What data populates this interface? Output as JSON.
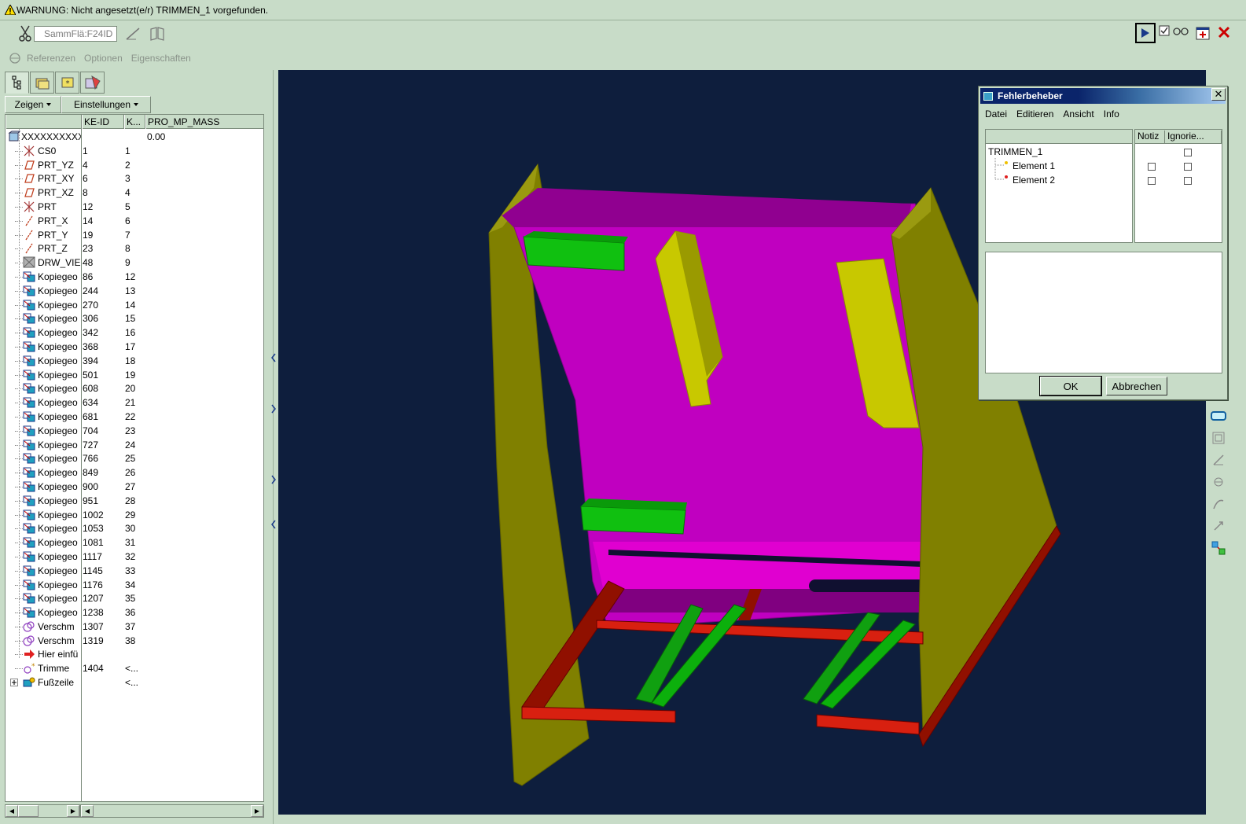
{
  "warning": {
    "text": "WARNUNG: Nicht angesetzt(e/r) TRIMMEN_1 vorgefunden."
  },
  "dashboard": {
    "collector_value": "SammFlä:F24ID",
    "tabs": [
      "Referenzen",
      "Optionen",
      "Eigenschaften"
    ]
  },
  "navigator": {
    "menus": {
      "show": "Zeigen",
      "settings": "Einstellungen"
    },
    "columns": [
      "KE-ID",
      "K...",
      "PRO_MP_MASS"
    ],
    "root": {
      "name": "XXXXXXXXXX",
      "mass": "0.00"
    },
    "rows": [
      {
        "name": "CS0",
        "ke": "1",
        "k": "1",
        "icon": "csys-icon"
      },
      {
        "name": "PRT_YZ",
        "ke": "4",
        "k": "2",
        "icon": "datum-plane-icon"
      },
      {
        "name": "PRT_XY",
        "ke": "6",
        "k": "3",
        "icon": "datum-plane-icon"
      },
      {
        "name": "PRT_XZ",
        "ke": "8",
        "k": "4",
        "icon": "datum-plane-icon"
      },
      {
        "name": "PRT",
        "ke": "12",
        "k": "5",
        "icon": "csys-icon"
      },
      {
        "name": "PRT_X",
        "ke": "14",
        "k": "6",
        "icon": "datum-axis-icon"
      },
      {
        "name": "PRT_Y",
        "ke": "19",
        "k": "7",
        "icon": "datum-axis-icon"
      },
      {
        "name": "PRT_Z",
        "ke": "23",
        "k": "8",
        "icon": "datum-axis-icon"
      },
      {
        "name": "DRW_VIE",
        "ke": "48",
        "k": "9",
        "icon": "view-icon"
      },
      {
        "name": "Kopiegeo",
        "ke": "86",
        "k": "12",
        "icon": "copy-geom-icon"
      },
      {
        "name": "Kopiegeo",
        "ke": "244",
        "k": "13",
        "icon": "copy-geom-icon"
      },
      {
        "name": "Kopiegeo",
        "ke": "270",
        "k": "14",
        "icon": "copy-geom-icon"
      },
      {
        "name": "Kopiegeo",
        "ke": "306",
        "k": "15",
        "icon": "copy-geom-icon"
      },
      {
        "name": "Kopiegeo",
        "ke": "342",
        "k": "16",
        "icon": "copy-geom-icon"
      },
      {
        "name": "Kopiegeo",
        "ke": "368",
        "k": "17",
        "icon": "copy-geom-icon"
      },
      {
        "name": "Kopiegeo",
        "ke": "394",
        "k": "18",
        "icon": "copy-geom-icon"
      },
      {
        "name": "Kopiegeo",
        "ke": "501",
        "k": "19",
        "icon": "copy-geom-icon"
      },
      {
        "name": "Kopiegeo",
        "ke": "608",
        "k": "20",
        "icon": "copy-geom-icon"
      },
      {
        "name": "Kopiegeo",
        "ke": "634",
        "k": "21",
        "icon": "copy-geom-icon"
      },
      {
        "name": "Kopiegeo",
        "ke": "681",
        "k": "22",
        "icon": "copy-geom-icon"
      },
      {
        "name": "Kopiegeo",
        "ke": "704",
        "k": "23",
        "icon": "copy-geom-icon"
      },
      {
        "name": "Kopiegeo",
        "ke": "727",
        "k": "24",
        "icon": "copy-geom-icon"
      },
      {
        "name": "Kopiegeo",
        "ke": "766",
        "k": "25",
        "icon": "copy-geom-icon"
      },
      {
        "name": "Kopiegeo",
        "ke": "849",
        "k": "26",
        "icon": "copy-geom-icon"
      },
      {
        "name": "Kopiegeo",
        "ke": "900",
        "k": "27",
        "icon": "copy-geom-icon"
      },
      {
        "name": "Kopiegeo",
        "ke": "951",
        "k": "28",
        "icon": "copy-geom-icon"
      },
      {
        "name": "Kopiegeo",
        "ke": "1002",
        "k": "29",
        "icon": "copy-geom-icon"
      },
      {
        "name": "Kopiegeo",
        "ke": "1053",
        "k": "30",
        "icon": "copy-geom-icon"
      },
      {
        "name": "Kopiegeo",
        "ke": "1081",
        "k": "31",
        "icon": "copy-geom-icon"
      },
      {
        "name": "Kopiegeo",
        "ke": "1117",
        "k": "32",
        "icon": "copy-geom-icon"
      },
      {
        "name": "Kopiegeo",
        "ke": "1145",
        "k": "33",
        "icon": "copy-geom-icon"
      },
      {
        "name": "Kopiegeo",
        "ke": "1176",
        "k": "34",
        "icon": "copy-geom-icon"
      },
      {
        "name": "Kopiegeo",
        "ke": "1207",
        "k": "35",
        "icon": "copy-geom-icon"
      },
      {
        "name": "Kopiegeo",
        "ke": "1238",
        "k": "36",
        "icon": "copy-geom-icon"
      },
      {
        "name": "Verschm",
        "ke": "1307",
        "k": "37",
        "icon": "merge-icon"
      },
      {
        "name": "Verschm",
        "ke": "1319",
        "k": "38",
        "icon": "merge-icon"
      },
      {
        "name": "Hier einfü",
        "ke": "",
        "k": "",
        "icon": "insert-here-icon"
      },
      {
        "name": "Trimme",
        "ke": "1404",
        "k": "<...",
        "icon": "trim-icon"
      },
      {
        "name": "Fußzeile",
        "ke": "",
        "k": "<...",
        "icon": "footer-icon"
      }
    ]
  },
  "dialog": {
    "title": "Fehlerbeheber",
    "close": "✕",
    "menu": [
      "Datei",
      "Editieren",
      "Ansicht",
      "Info"
    ],
    "columns": {
      "note": "Notiz",
      "ignore": "Ignorie..."
    },
    "tree": {
      "root": "TRIMMEN_1",
      "items": [
        "Element 1",
        "Element 2"
      ]
    },
    "ok": "OK",
    "cancel": "Abbrechen"
  },
  "colors": {
    "background": "#c8dcc8",
    "viewport": "#0e1e3d",
    "olive": "#808000",
    "magenta": "#c000c0",
    "green": "#10c010",
    "red": "#c81e0a",
    "yellow": "#c8c800"
  }
}
